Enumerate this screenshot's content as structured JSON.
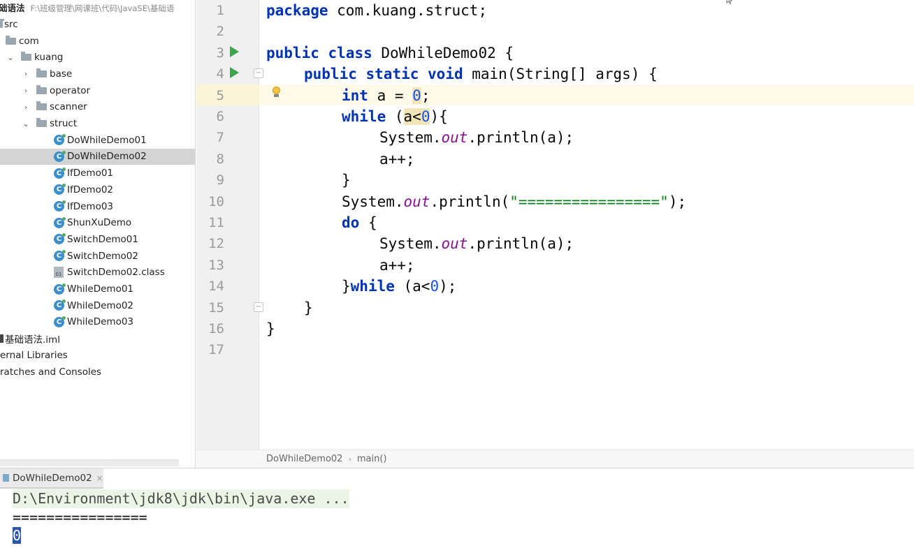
{
  "project": {
    "header_name": "础语法",
    "header_path": "F:\\班级管理\\网课班\\代码\\JavaSE\\基础语",
    "items": [
      {
        "label": "src"
      },
      {
        "label": "com"
      },
      {
        "label": "kuang"
      },
      {
        "label": "base"
      },
      {
        "label": "operator"
      },
      {
        "label": "scanner"
      },
      {
        "label": "struct"
      },
      {
        "label": "DoWhileDemo01"
      },
      {
        "label": "DoWhileDemo02"
      },
      {
        "label": "IfDemo01"
      },
      {
        "label": "IfDemo02"
      },
      {
        "label": "IfDemo03"
      },
      {
        "label": "ShunXuDemo"
      },
      {
        "label": "SwitchDemo01"
      },
      {
        "label": "SwitchDemo02"
      },
      {
        "label": "SwitchDemo02.class"
      },
      {
        "label": "WhileDemo01"
      },
      {
        "label": "WhileDemo02"
      },
      {
        "label": "WhileDemo03"
      },
      {
        "label": "基础语法.iml"
      },
      {
        "label": "ernal Libraries"
      },
      {
        "label": "ratches and Consoles"
      }
    ]
  },
  "editor": {
    "line_numbers": [
      "1",
      "2",
      "3",
      "4",
      "5",
      "6",
      "7",
      "8",
      "9",
      "10",
      "11",
      "12",
      "13",
      "14",
      "15",
      "16",
      "17"
    ],
    "code": {
      "l1_kw": "package",
      "l1_rest": " com.kuang.struct;",
      "l3_kw1": "public",
      "l3_kw2": "class",
      "l3_rest": " DoWhileDemo02 {",
      "l4_kw1": "public",
      "l4_kw2": "static",
      "l4_kw3": "void",
      "l4_rest": " main(String[] args) {",
      "l5_kw": "int",
      "l5_mid": " a = ",
      "l5_num": "0",
      "l5_end": ";",
      "l6_kw": "while",
      "l6_p1": " (",
      "l6_var": "a<",
      "l6_num": "0",
      "l6_end": "){",
      "l7_a": "System.",
      "l7_fld": "out",
      "l7_b": ".println(a);",
      "l8": "a++;",
      "l9": "}",
      "l10_a": "System.",
      "l10_fld": "out",
      "l10_b": ".println(",
      "l10_str": "\"================\"",
      "l10_c": ");",
      "l11_kw": "do",
      "l11_rest": " {",
      "l12_a": "System.",
      "l12_fld": "out",
      "l12_b": ".println(a);",
      "l13": "a++;",
      "l14_a": "}",
      "l14_kw": "while",
      "l14_b": " (a<",
      "l14_num": "0",
      "l14_c": ");",
      "l15": "}",
      "l16": "}"
    },
    "breadcrumb": {
      "class": "DoWhileDemo02",
      "method": "main()"
    }
  },
  "run": {
    "tab_label": "DoWhileDemo02",
    "tab_close": "×",
    "cmd": "D:\\Environment\\jdk8\\jdk\\bin\\java.exe ...",
    "output1": "================",
    "output2": "0"
  }
}
